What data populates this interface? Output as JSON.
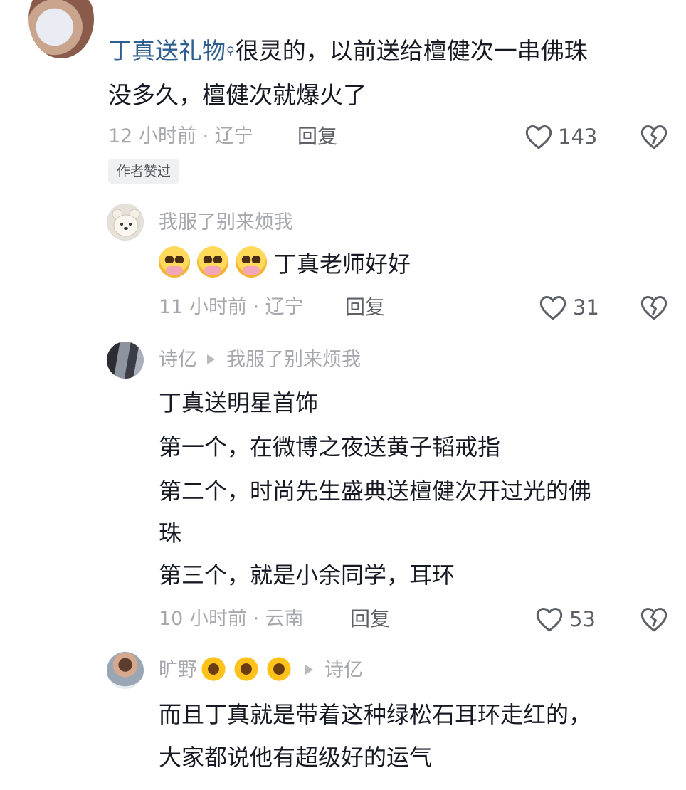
{
  "comments": [
    {
      "link_text": "丁真送礼物",
      "text_line1_rest": "很灵的，以前送给檀健次一串佛珠",
      "text_line2": "没多久，檀健次就爆火了",
      "meta": "12 小时前 · 辽宁",
      "reply": "回复",
      "likes": "143",
      "badge": "作者赞过"
    },
    {
      "username": "我服了别来烦我",
      "text": "丁真老师好好",
      "meta": "11 小时前 · 辽宁",
      "reply": "回复",
      "likes": "31"
    },
    {
      "username": "诗亿",
      "reply_to": "我服了别来烦我",
      "lines": [
        "丁真送明星首饰",
        "第一个，在微博之夜送黄子韬戒指",
        "第二个，时尚先生盛典送檀健次开过光的佛",
        "珠",
        "第三个，就是小余同学，耳环"
      ],
      "meta": "10 小时前 · 云南",
      "reply": "回复",
      "likes": "53"
    },
    {
      "username": "旷野",
      "reply_to": "诗亿",
      "lines": [
        "而且丁真就是带着这种绿松石耳环走红的，",
        "大家都说他有超级好的运气"
      ]
    }
  ],
  "icons": {
    "like": "heart-outline-icon",
    "dislike": "broken-heart-icon",
    "search": "search-icon",
    "reply_arrow": "triangle-right-icon"
  }
}
